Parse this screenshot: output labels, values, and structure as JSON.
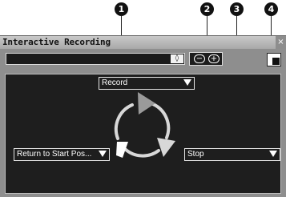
{
  "callouts": {
    "c1": "1",
    "c2": "2",
    "c3": "3",
    "c4": "4"
  },
  "window": {
    "title": "Interactive Recording",
    "close_glyph": "×"
  },
  "toolbar": {
    "file_field_value": "",
    "file_button_glyph": "◊",
    "zoom_out_glyph": "−",
    "zoom_in_glyph": "+"
  },
  "controls": {
    "record_dropdown": "Record",
    "return_dropdown": "Return to Start Pos...",
    "stop_dropdown": "Stop"
  },
  "colors": {
    "panel_background": "#1e1e1e",
    "window_frame": "#8e8e8e",
    "cycle_arrows": "#d8d8d8"
  },
  "icons": {
    "cycle": "cycle-arrows-icon",
    "dropdown": "dropdown-arrow-icon",
    "file": "file-browse-icon",
    "zoom_out": "zoom-out-icon",
    "zoom_in": "zoom-in-icon",
    "view": "view-toggle-icon"
  }
}
